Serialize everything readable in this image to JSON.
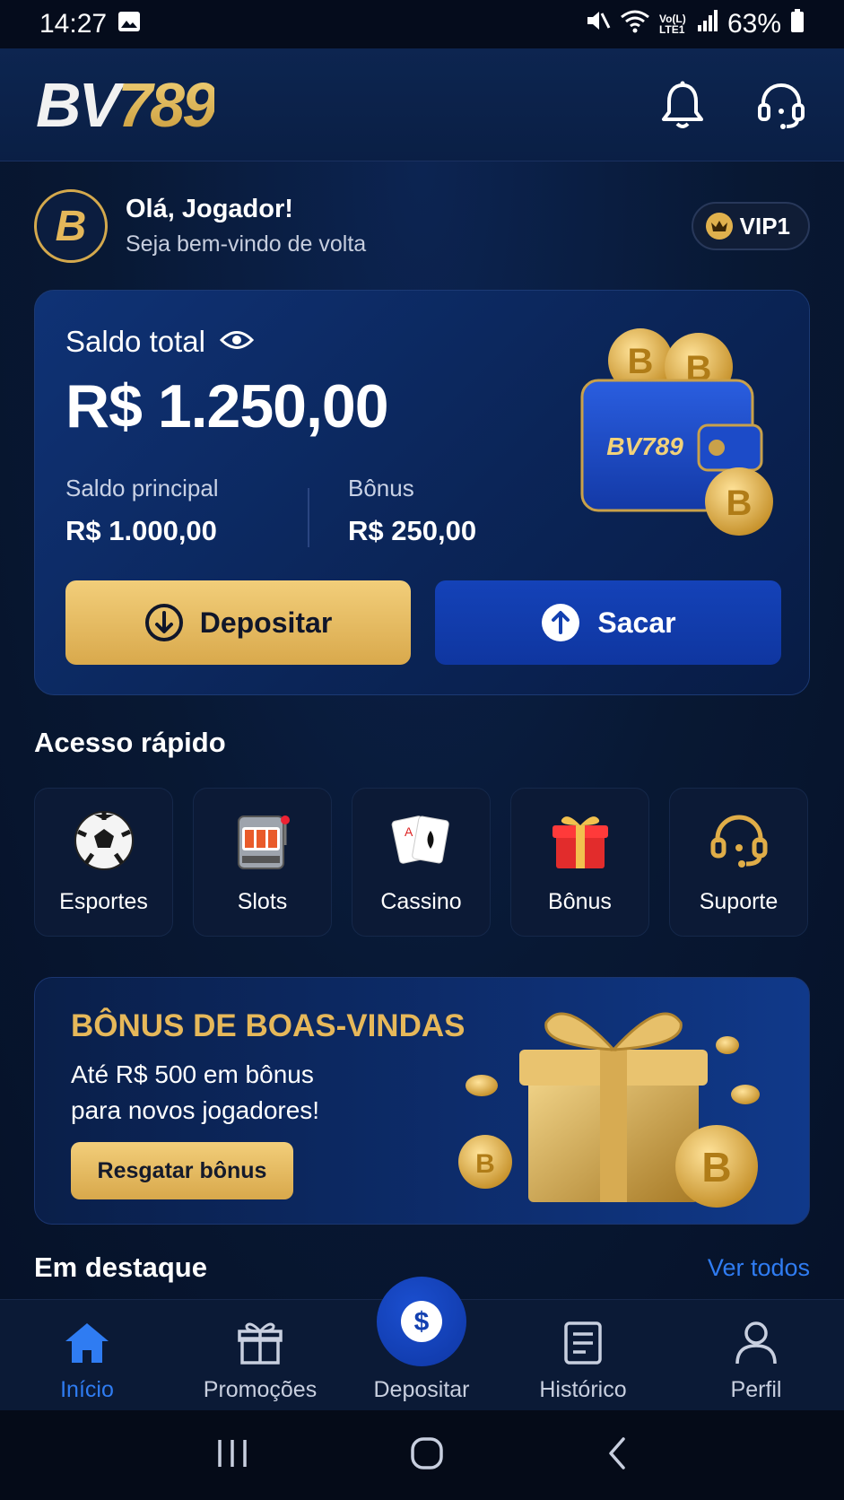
{
  "status_bar": {
    "time": "14:27",
    "network": "Vo(L) LTE1",
    "battery": "63%"
  },
  "header": {
    "logo_text_1": "BV",
    "logo_text_2": "789",
    "notification_icon": "bell-icon",
    "support_icon": "headset-icon"
  },
  "greeting": {
    "avatar_letter": "B",
    "title": "Olá, Jogador!",
    "subtitle": "Seja bem-vindo de volta",
    "vip_label": "VIP1"
  },
  "balance": {
    "label": "Saldo total",
    "total": "R$ 1.250,00",
    "main_label": "Saldo principal",
    "main_value": "R$ 1.000,00",
    "bonus_label": "Bônus",
    "bonus_value": "R$ 250,00",
    "wallet_brand": "BV789",
    "deposit_label": "Depositar",
    "withdraw_label": "Sacar"
  },
  "quick_access": {
    "title": "Acesso rápido",
    "items": [
      {
        "label": "Esportes",
        "icon": "soccer-ball-icon"
      },
      {
        "label": "Slots",
        "icon": "slot-machine-icon"
      },
      {
        "label": "Cassino",
        "icon": "playing-cards-icon"
      },
      {
        "label": "Bônus",
        "icon": "gift-icon"
      },
      {
        "label": "Suporte",
        "icon": "headset-icon"
      }
    ]
  },
  "promo": {
    "title": "BÔNUS DE BOAS-VINDAS",
    "line1": "Até R$ 500 em bônus",
    "line2": "para novos jogadores!",
    "cta": "Resgatar bônus"
  },
  "featured": {
    "title": "Em destaque",
    "see_all": "Ver todos"
  },
  "bottom_nav": {
    "items": [
      {
        "label": "Início",
        "icon": "home-icon",
        "active": true
      },
      {
        "label": "Promoções",
        "icon": "gift-icon"
      },
      {
        "label": "Depositar",
        "icon": "dollar-icon"
      },
      {
        "label": "Histórico",
        "icon": "document-icon"
      },
      {
        "label": "Perfil",
        "icon": "user-icon"
      }
    ]
  },
  "colors": {
    "accent_gold": "#e0b14d",
    "accent_blue": "#2f7cf2",
    "background": "#06132b"
  }
}
